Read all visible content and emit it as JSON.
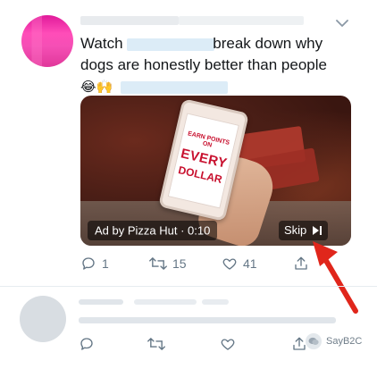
{
  "tweet": {
    "text_prefix": "Watch",
    "text_mid": "break down why",
    "text_line2": "dogs are honestly better than people",
    "emoji": "😂🙌",
    "media": {
      "phone_line1": "EARN POINTS ON",
      "phone_line2": "EVERY",
      "phone_line3": "DOLLAR",
      "ad_label": "Ad by Pizza Hut · 0:10",
      "skip_label": "Skip"
    },
    "actions": {
      "reply_count": "1",
      "retweet_count": "15",
      "like_count": "41"
    }
  },
  "watermark": {
    "text": "SayB2C"
  },
  "colors": {
    "icon_gray": "#657786",
    "arrow_red": "#e0261b",
    "avatar_pink": "#e01a9a"
  }
}
